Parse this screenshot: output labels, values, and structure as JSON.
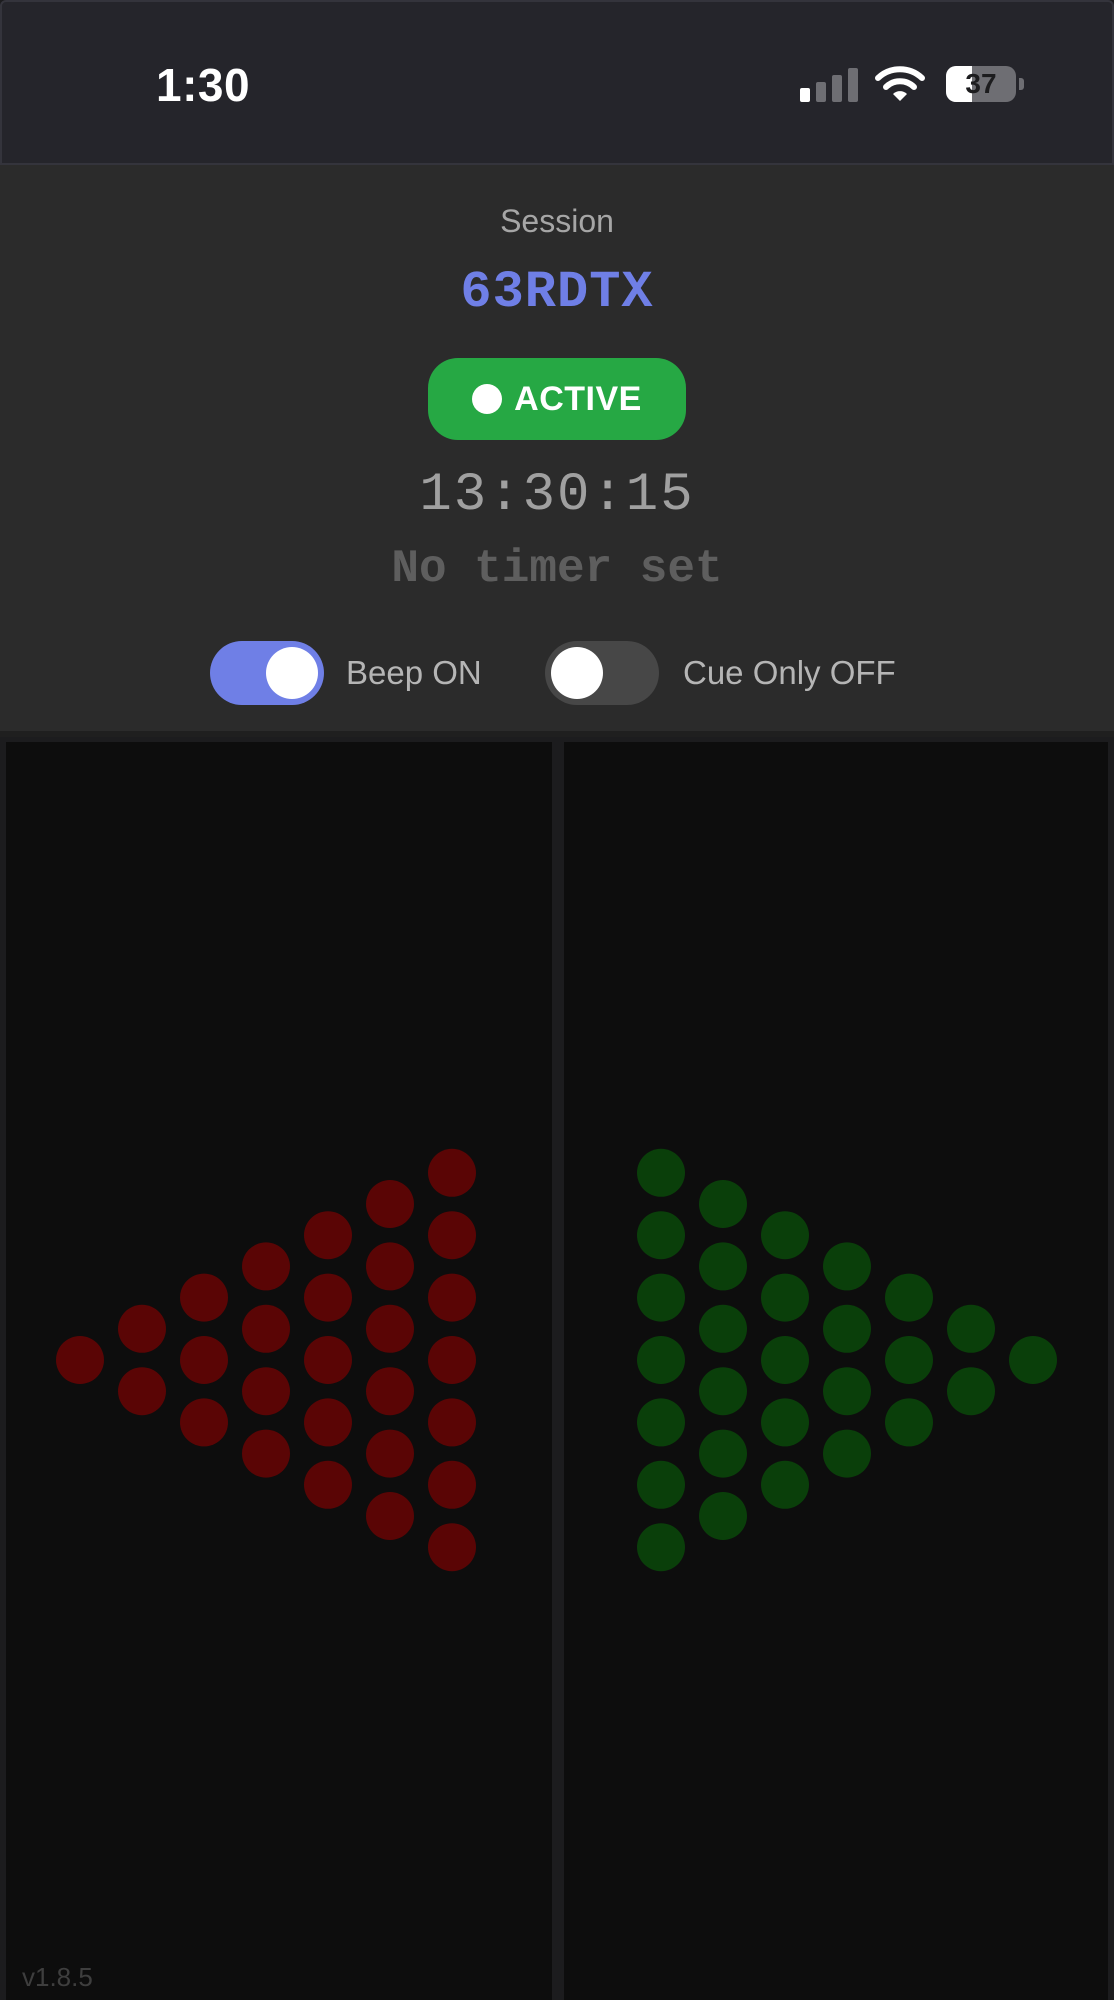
{
  "status_bar": {
    "time": "1:30",
    "battery": "37",
    "battery_level": 0.37
  },
  "session": {
    "label": "Session",
    "code": "63RDTX",
    "status": "ACTIVE",
    "clock": "13:30:15",
    "timer": "No timer set"
  },
  "toggles": {
    "beep": {
      "label": "Beep ON",
      "on": true
    },
    "cue_only": {
      "label": "Cue Only OFF",
      "on": false
    }
  },
  "signals": {
    "left": {
      "icon": "left-arrow-led-icon",
      "color": "#5a0505"
    },
    "right": {
      "icon": "right-arrow-led-icon",
      "color": "#0a3f0a"
    }
  },
  "colors": {
    "accent": "#6f7fe6",
    "active": "#26a844"
  },
  "footer": {
    "version": "v1.8.5"
  }
}
